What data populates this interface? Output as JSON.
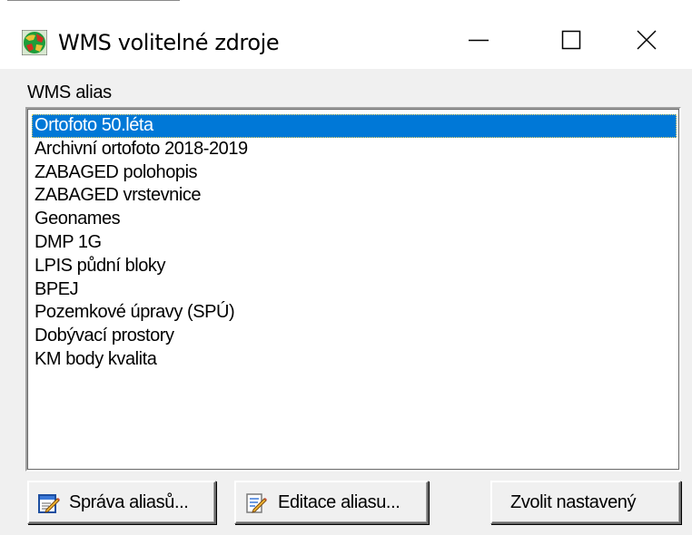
{
  "window": {
    "title": "WMS volitelné zdroje",
    "controls": {
      "minimize": "minimize",
      "maximize": "maximize",
      "close": "close"
    }
  },
  "alias_label": "WMS alias",
  "list": {
    "selected_index": 0,
    "items": [
      "Ortofoto 50.léta",
      "Archivní ortofoto 2018-2019",
      "ZABAGED polohopis",
      "ZABAGED vrstevnice",
      "Geonames",
      "DMP 1G",
      "LPIS půdní bloky",
      "BPEJ",
      "Pozemkové úpravy (SPÚ)",
      "Dobývací prostory",
      "KM body kvalita"
    ]
  },
  "buttons": {
    "sprava": "Správa aliasů...",
    "editace": "Editace aliasu...",
    "zvolit": "Zvolit nastavený"
  },
  "colors": {
    "selection": "#0078d7",
    "face": "#f0f0f0"
  }
}
